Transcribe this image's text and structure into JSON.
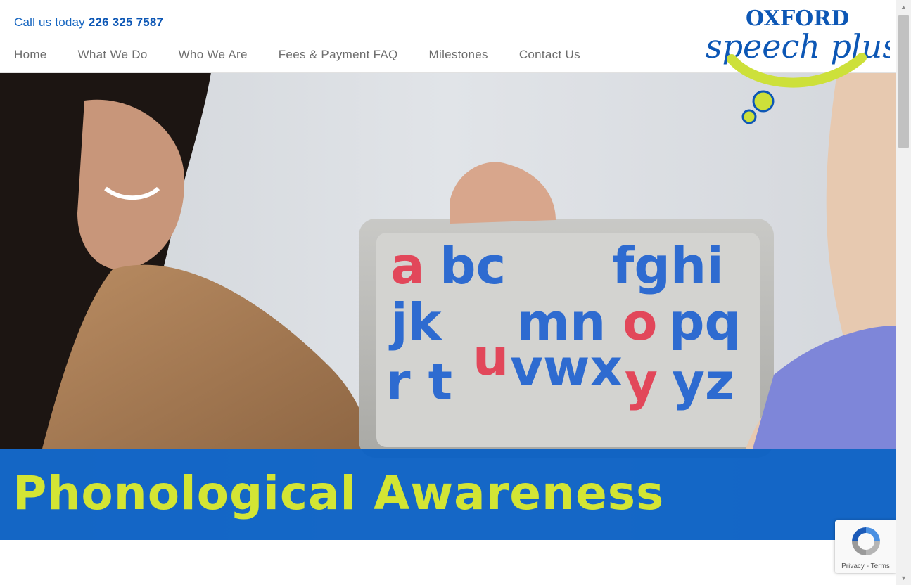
{
  "header": {
    "call_prefix": "Call us today",
    "phone": "226 325 7587"
  },
  "nav": [
    {
      "label": "Home"
    },
    {
      "label": "What We Do"
    },
    {
      "label": "Who We Are"
    },
    {
      "label": "Fees & Payment FAQ"
    },
    {
      "label": "Milestones"
    },
    {
      "label": "Contact Us"
    }
  ],
  "logo": {
    "line1": "OXFORD",
    "line2": "speech plus"
  },
  "hero": {
    "title": "Phonological Awareness",
    "board_letters": "abc fghi jk mnopq rtuvwxyyz"
  },
  "recaptcha": {
    "privacy": "Privacy",
    "separator": " - ",
    "terms": "Terms"
  },
  "colors": {
    "brand_blue": "#0d57b5",
    "brand_lime": "#cde03a",
    "banner_blue": "#0a60c4",
    "nav_text": "#6d6d6d"
  }
}
